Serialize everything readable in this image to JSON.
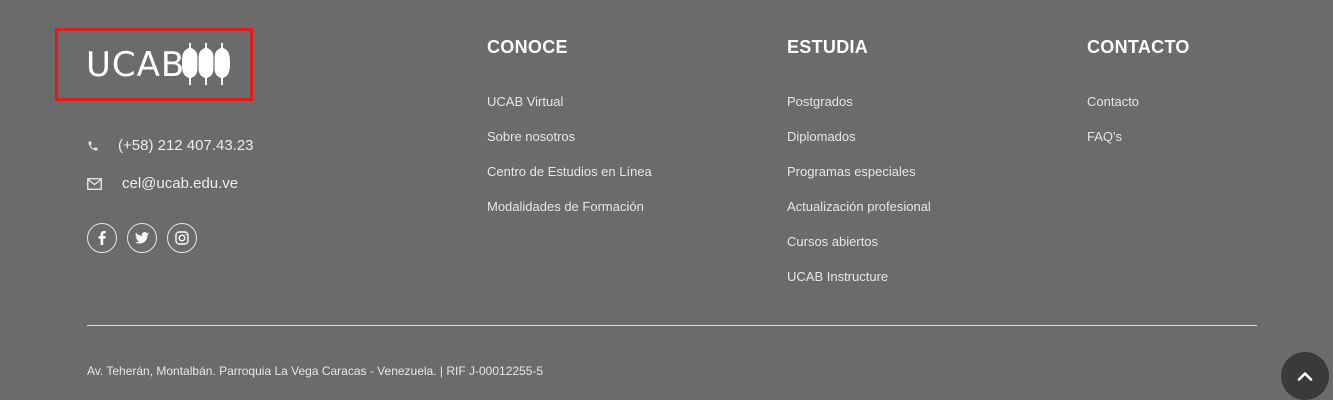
{
  "logo": {
    "text": "UCAB"
  },
  "contact": {
    "phone": "(+58) 212 407.43.23",
    "email": "cel@ucab.edu.ve"
  },
  "social": [
    {
      "icon": "facebook-icon"
    },
    {
      "icon": "twitter-icon"
    },
    {
      "icon": "instagram-icon"
    }
  ],
  "columns": {
    "conoce": {
      "title": "CONOCE",
      "links": [
        "UCAB Virtual",
        "Sobre nosotros",
        "Centro de Estudios en Línea",
        "Modalidades de Formación"
      ]
    },
    "estudia": {
      "title": "ESTUDIA",
      "links": [
        "Postgrados",
        "Diplomados",
        "Programas especiales",
        "Actualización profesional",
        "Cursos abiertos",
        "UCAB Instructure"
      ]
    },
    "contacto": {
      "title": "CONTACTO",
      "links": [
        "Contacto",
        "FAQ's"
      ]
    }
  },
  "footer": {
    "address": "Av. Teherán, Montalbán. Parroquia La Vega Caracas - Venezuela. | RIF J-00012255-5"
  },
  "colors": {
    "background": "#6b6b6b",
    "highlight_border": "#e21b1b",
    "back_to_top": "#3a3a3a"
  }
}
